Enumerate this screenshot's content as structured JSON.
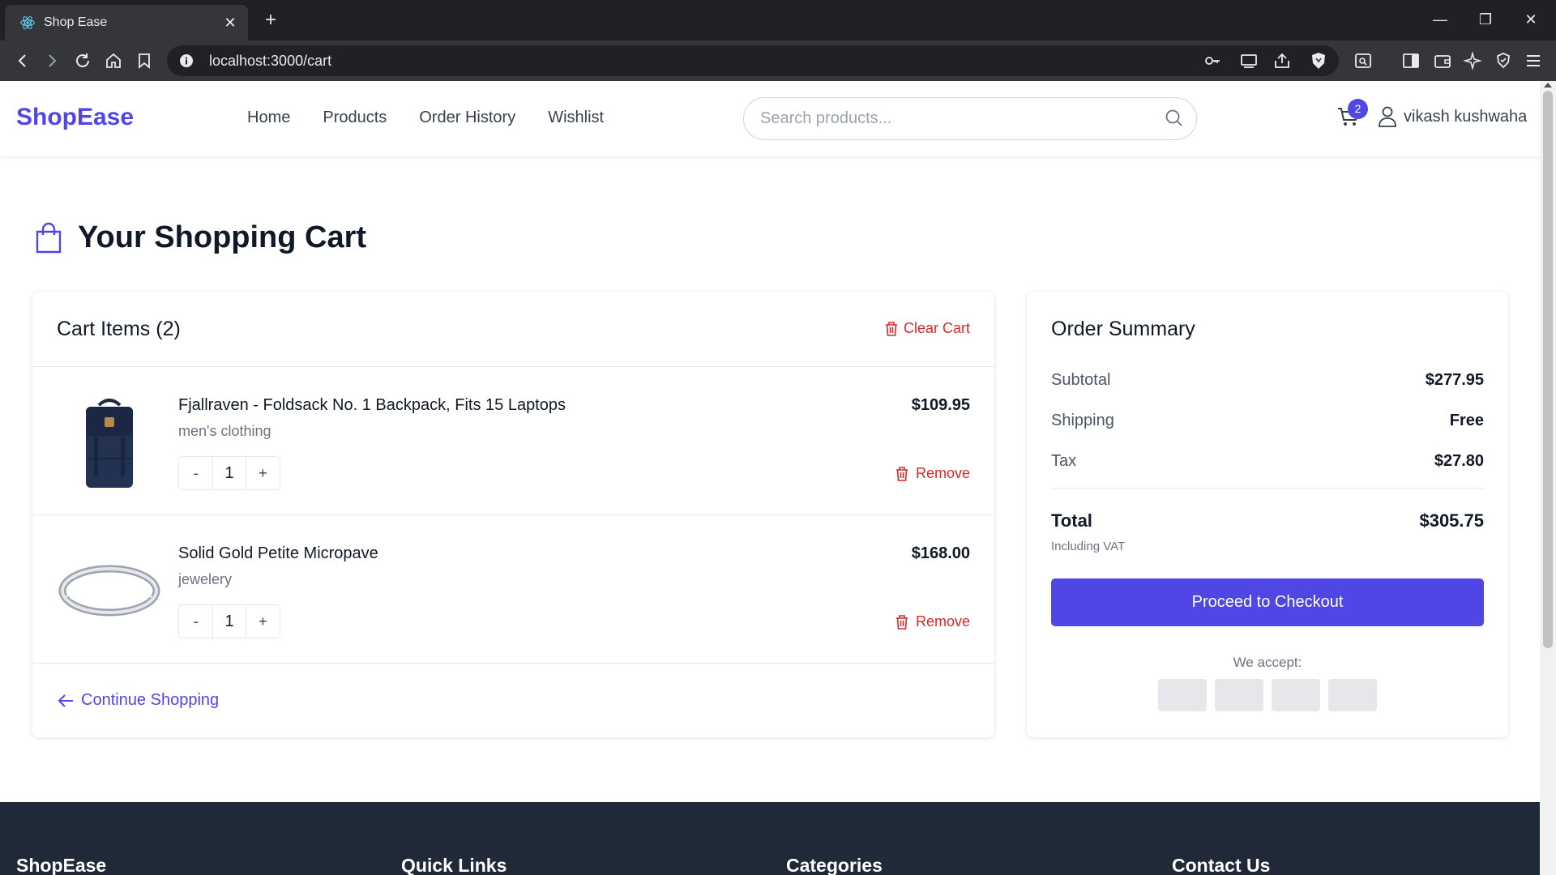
{
  "browser": {
    "tab_title": "Shop Ease",
    "tab_close": "✕",
    "new_tab": "+",
    "url": "localhost:3000/cart",
    "window_controls": {
      "minimize": "—",
      "maximize": "❐",
      "close": "✕"
    }
  },
  "header": {
    "logo": "ShopEase",
    "nav": [
      "Home",
      "Products",
      "Order History",
      "Wishlist"
    ],
    "search_placeholder": "Search products...",
    "cart_count": "2",
    "user_name": "vikash kushwaha"
  },
  "page": {
    "title": "Your Shopping Cart"
  },
  "cart": {
    "heading": "Cart Items (2)",
    "clear_label": "Clear Cart",
    "items": [
      {
        "name": "Fjallraven - Foldsack No. 1 Backpack, Fits 15 Laptops",
        "category": "men's clothing",
        "price": "$109.95",
        "quantity": "1",
        "image": "backpack-image"
      },
      {
        "name": "Solid Gold Petite Micropave",
        "category": "jewelery",
        "price": "$168.00",
        "quantity": "1",
        "image": "ring-image"
      }
    ],
    "qty_minus": "-",
    "qty_plus": "+",
    "remove_label": "Remove",
    "continue_label": "Continue Shopping"
  },
  "summary": {
    "heading": "Order Summary",
    "subtotal_label": "Subtotal",
    "subtotal": "$277.95",
    "shipping_label": "Shipping",
    "shipping": "Free",
    "tax_label": "Tax",
    "tax": "$27.80",
    "total_label": "Total",
    "total": "$305.75",
    "vat_note": "Including VAT",
    "checkout_label": "Proceed to Checkout",
    "accept_label": "We accept:"
  },
  "footer": {
    "columns": [
      "ShopEase",
      "Quick Links",
      "Categories",
      "Contact Us"
    ]
  },
  "colors": {
    "brand": "#4f46e5",
    "danger": "#dc2626",
    "footer": "#1f2937"
  }
}
